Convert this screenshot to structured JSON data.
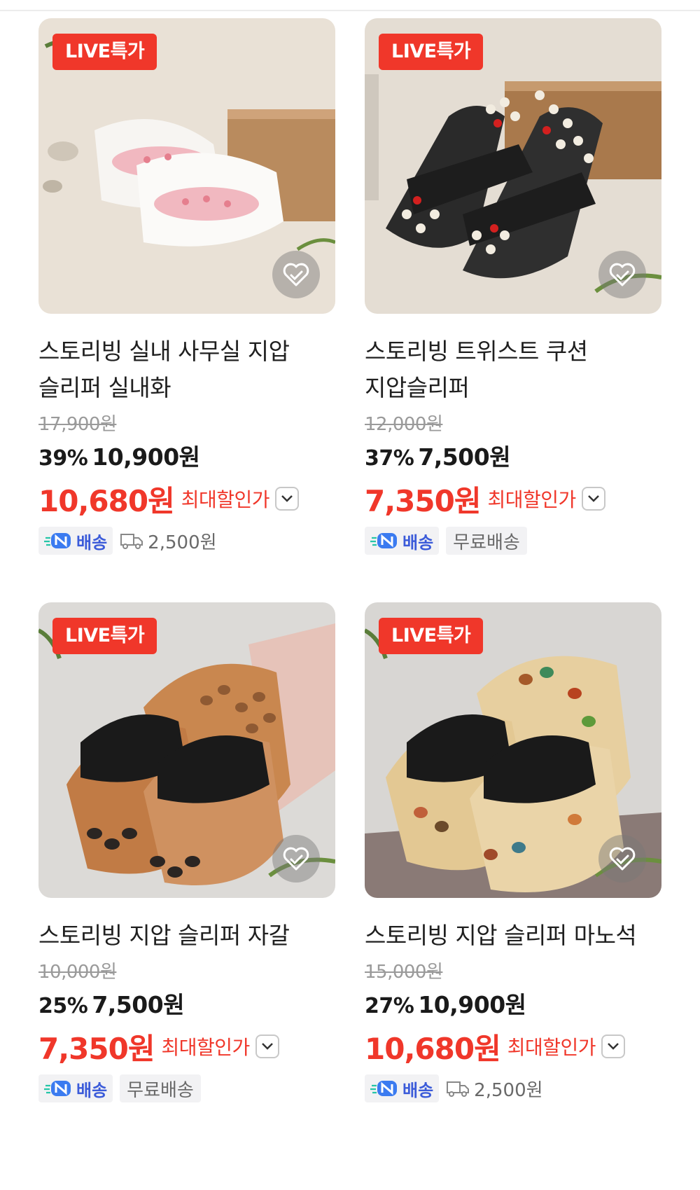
{
  "badge_label": "LIVE특가",
  "max_discount_label": "최대할인가",
  "ndelivery_label": "배송",
  "colors": {
    "accent": "#f0372a",
    "ndelivery": "#3b5bd9"
  },
  "icons": [
    "heart-check-icon",
    "chevron-down-icon",
    "truck-icon",
    "n-delivery-icon"
  ],
  "products": [
    {
      "title": "스토리빙 실내 사무실 지압 슬리퍼 실내화",
      "original_price": "17,900원",
      "discount_rate": "39%",
      "sale_price": "10,900원",
      "max_discount_price": "10,680원",
      "shipping_fee": "2,500원",
      "free_shipping": false
    },
    {
      "title": "스토리빙 트위스트 쿠션 지압슬리퍼",
      "original_price": "12,000원",
      "discount_rate": "37%",
      "sale_price": "7,500원",
      "max_discount_price": "7,350원",
      "shipping_fee": "무료배송",
      "free_shipping": true
    },
    {
      "title": "스토리빙 지압 슬리퍼 자갈",
      "original_price": "10,000원",
      "discount_rate": "25%",
      "sale_price": "7,500원",
      "max_discount_price": "7,350원",
      "shipping_fee": "무료배송",
      "free_shipping": true
    },
    {
      "title": "스토리빙 지압 슬리퍼 마노석",
      "original_price": "15,000원",
      "discount_rate": "27%",
      "sale_price": "10,900원",
      "max_discount_price": "10,680원",
      "shipping_fee": "2,500원",
      "free_shipping": false
    }
  ]
}
